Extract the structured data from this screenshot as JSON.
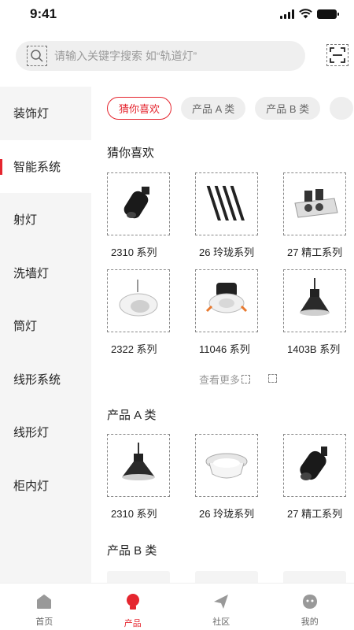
{
  "status": {
    "time": "9:41"
  },
  "search": {
    "placeholder": "请输入关键字搜索 如“轨道灯”"
  },
  "sidebar": {
    "items": [
      {
        "label": "装饰灯"
      },
      {
        "label": "智能系统"
      },
      {
        "label": "射灯"
      },
      {
        "label": "洗墙灯"
      },
      {
        "label": "筒灯"
      },
      {
        "label": "线形系统"
      },
      {
        "label": "线形灯"
      },
      {
        "label": "柜内灯"
      }
    ],
    "active_index": 1
  },
  "chips": [
    {
      "label": "猜你喜欢"
    },
    {
      "label": "产品 A 类"
    },
    {
      "label": "产品 B 类"
    }
  ],
  "sections": [
    {
      "title": "猜你喜欢",
      "products": [
        {
          "name": "2310 系列",
          "icon": "spotlight-track-icon"
        },
        {
          "name": "26 玲珑系列",
          "icon": "linear-bars-icon"
        },
        {
          "name": "27 精工系列",
          "icon": "grille-light-icon"
        },
        {
          "name": "2322 系列",
          "icon": "adjustable-downlight-icon"
        },
        {
          "name": "11046 系列",
          "icon": "downlight-icon"
        },
        {
          "name": "1403B 系列",
          "icon": "pendant-icon"
        }
      ],
      "more_label": "查看更多"
    },
    {
      "title": "产品 A 类",
      "products": [
        {
          "name": "2310 系列",
          "icon": "pendant-icon"
        },
        {
          "name": "26 玲珑系列",
          "icon": "recessed-ring-icon"
        },
        {
          "name": "27 精工系列",
          "icon": "spotlight-track-icon"
        }
      ]
    },
    {
      "title": "产品 B 类"
    }
  ],
  "tabbar": {
    "items": [
      {
        "label": "首页",
        "icon": "home-icon"
      },
      {
        "label": "产品",
        "icon": "bulb-icon"
      },
      {
        "label": "社区",
        "icon": "paper-plane-icon"
      },
      {
        "label": "我的",
        "icon": "profile-icon"
      }
    ],
    "active_index": 1
  },
  "colors": {
    "accent": "#e5262f",
    "sidebar_bg": "#f5f5f5",
    "chip_bg": "#eeeeee"
  }
}
